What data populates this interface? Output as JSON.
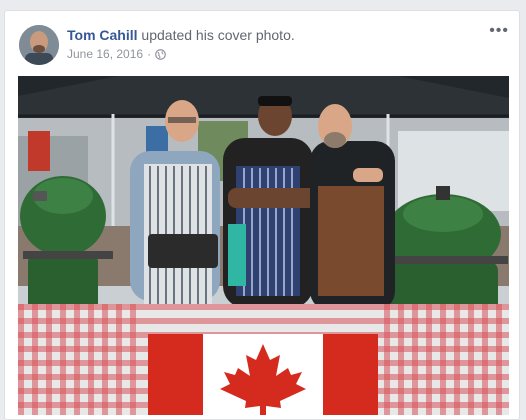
{
  "post": {
    "author": "Tom Cahill",
    "action": "updated his cover photo.",
    "date": "June 16, 2016",
    "privacy_icon": "globe-icon",
    "more_icon": "more-options-icon",
    "more_label": "•••"
  },
  "colors": {
    "link": "#365899",
    "secondary_text": "#90949c",
    "card_border": "#dddfe2",
    "page_bg": "#e9ebee",
    "grill_green": "#2f6b35",
    "flag_red": "#d52b1e",
    "tablecloth_red": "#d9545c"
  }
}
